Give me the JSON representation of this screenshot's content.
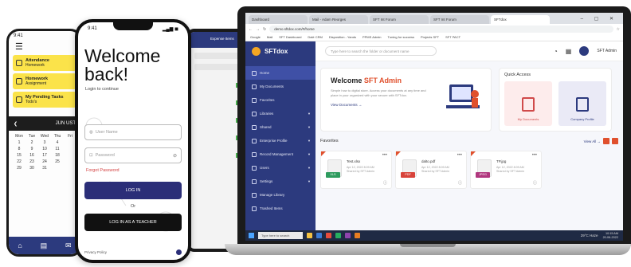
{
  "phone1": {
    "status_time": "9:41",
    "menu_icon": "hamburger-icon",
    "cards": [
      {
        "title": "Attendance",
        "sub": "Homework",
        "icon": "hand-icon"
      },
      {
        "title": "Homework",
        "sub": "Assignment",
        "icon": "book-icon"
      },
      {
        "title": "My Pending Tasks",
        "sub": "Todo's",
        "icon": "task-icon"
      }
    ],
    "calendar_month": "JUN UST",
    "weekdays": [
      "Mon",
      "Tue",
      "Wed",
      "Thu",
      "Fri"
    ],
    "days": [
      "1",
      "2",
      "3",
      "4",
      "",
      "8",
      "9",
      "10",
      "11",
      "",
      "15",
      "16",
      "17",
      "18",
      "",
      "22",
      "23",
      "24",
      "25",
      "",
      "29",
      "30",
      "31",
      "",
      ""
    ],
    "nav": [
      "home-icon",
      "book-icon",
      "message-icon"
    ]
  },
  "phone2": {
    "status_time": "9:41",
    "status_right": "▂▄▆ ◼",
    "title_line1": "Welcome",
    "title_line2": "back!",
    "subtitle": "Login to continue",
    "username_placeholder": "User Name",
    "password_placeholder": "Password",
    "forgot": "Forgot Password",
    "login_button": "LOG IN",
    "or": "Or",
    "teacher_button": "LOG IN AS A TEACHER",
    "footer_left": "Privacy Policy"
  },
  "tablet": {
    "header": "Expense Items"
  },
  "browser": {
    "tabs": [
      "Dashboard",
      "Mail - Adam Reorges",
      "SFT Int Forum",
      "SFT Int Forum",
      "SFTdox"
    ],
    "url": "demo.sftdox.com/#/home",
    "bookmarks": [
      "Google",
      "Mail",
      "SFT Dashboard",
      "Dalé CRM",
      "Disposition - Yands",
      "PPMS Admin",
      "Tuning for success",
      "Projects SFT",
      "SFT PACT"
    ]
  },
  "app": {
    "brand": "SFTdox",
    "search_placeholder": "Type here to search the folder or document name",
    "user_name": "SFT Admin",
    "sidebar": [
      {
        "label": "Home",
        "active": true,
        "chevron": false
      },
      {
        "label": "My Documents",
        "active": false,
        "chevron": false
      },
      {
        "label": "Favorites",
        "active": false,
        "chevron": false
      },
      {
        "label": "Libraries",
        "active": false,
        "chevron": true
      },
      {
        "label": "Shared",
        "active": false,
        "chevron": true
      },
      {
        "label": "Enterprise Profile",
        "active": false,
        "chevron": true
      },
      {
        "label": "Record Management",
        "active": false,
        "chevron": true
      },
      {
        "label": "Users",
        "active": false,
        "chevron": true
      },
      {
        "label": "Settings",
        "active": false,
        "chevron": true
      },
      {
        "label": "Manage Library",
        "active": false,
        "chevron": false
      },
      {
        "label": "Trashed Items",
        "active": false,
        "chevron": false
      }
    ],
    "welcome_prefix": "Welcome",
    "welcome_name": "SFT Admin",
    "welcome_text": "Simple how to digital store. Access your documents at any time and place in your organized with your secure with SFTdox.",
    "view_documents": "View Documents →",
    "quick_access_title": "Quick Access",
    "quick_access": [
      "My Documents",
      "Company Profile"
    ],
    "favorites_title": "Favorites",
    "view_all": "View All →",
    "favorites": [
      {
        "name": "Test.xlsx",
        "badge": "XLS",
        "color": "#2e9b5e",
        "meta1": "Apr 12, 2022 8:09 AM",
        "meta2": "Shared by SFT Admin"
      },
      {
        "name": "dalto.pdf",
        "badge": "PDF",
        "color": "#d8433a",
        "meta1": "Apr 12, 2022 8:09 AM",
        "meta2": "Shared by SFT Admin"
      },
      {
        "name": "TP.jpg",
        "badge": "JPEG",
        "color": "#b0377e",
        "meta1": "Apr 12, 2022 8:09 AM",
        "meta2": "Shared by SFT Admin"
      }
    ]
  },
  "taskbar": {
    "search": "Type here to search",
    "weather": "29°C Haze",
    "time": "10:15 AM",
    "date": "20-06-2022"
  },
  "colors": {
    "primary": "#2c3a7e",
    "accent": "#e0502d",
    "yellow": "#fbe34a"
  }
}
